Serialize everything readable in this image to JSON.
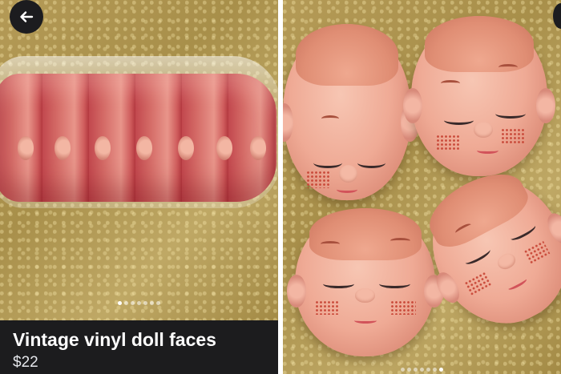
{
  "listing": {
    "title": "Vintage vinyl doll faces",
    "price": "$22"
  },
  "carousel": {
    "left_dot_count": 7,
    "left_active_index": 0,
    "right_dot_count": 7,
    "right_active_index": 6
  },
  "icons": {
    "back": "arrow-left-icon"
  },
  "colors": {
    "info_bar": "#1c1c1e",
    "title_text": "#ffffff",
    "back_button": "#1c1c1f"
  }
}
